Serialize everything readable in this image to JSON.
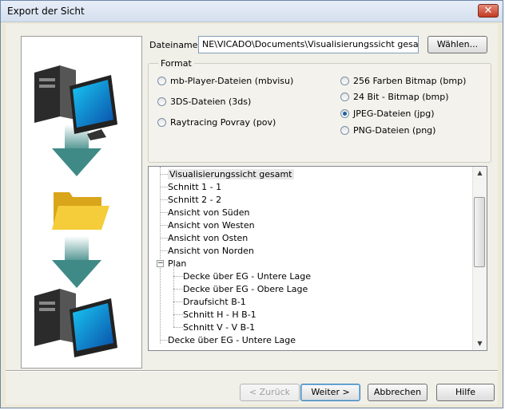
{
  "window": {
    "title": "Export der Sicht",
    "close_glyph": "✕"
  },
  "file": {
    "label": "Dateiname:",
    "value": "NE\\VICADO\\Documents\\Visualisierungssicht gesamt.jpg",
    "choose_button": "Wählen..."
  },
  "format": {
    "legend": "Format",
    "left_options": [
      "mb-Player-Dateien (mbvisu)",
      "3DS-Dateien (3ds)",
      "Raytracing Povray (pov)"
    ],
    "right_options": [
      "256 Farben Bitmap (bmp)",
      "24 Bit - Bitmap (bmp)",
      "JPEG-Dateien (jpg)",
      "PNG-Dateien (png)"
    ],
    "selected": "JPEG-Dateien (jpg)"
  },
  "tree": {
    "items": [
      "Visualisierungssicht gesamt",
      "Schnitt 1 - 1",
      "Schnitt 2 - 2",
      "Ansicht von Süden",
      "Ansicht von Westen",
      "Ansicht von Osten",
      "Ansicht von Norden",
      "Plan",
      "Decke über EG - Untere Lage",
      "Decke über EG - Obere Lage",
      "Draufsicht B-1",
      "Schnitt H - H B-1",
      "Schnitt V - V B-1",
      "Decke über EG - Untere Lage"
    ],
    "scroll_up": "▲",
    "scroll_down": "▼",
    "expander_glyph": "−"
  },
  "buttons": {
    "back": "< Zurück",
    "next": "Weiter >",
    "cancel": "Abbrechen",
    "help": "Hilfe"
  },
  "colors": {
    "selected_radio": "#1d5fa2",
    "arrow": "#3f8a86",
    "folder": "#f2c22a"
  }
}
